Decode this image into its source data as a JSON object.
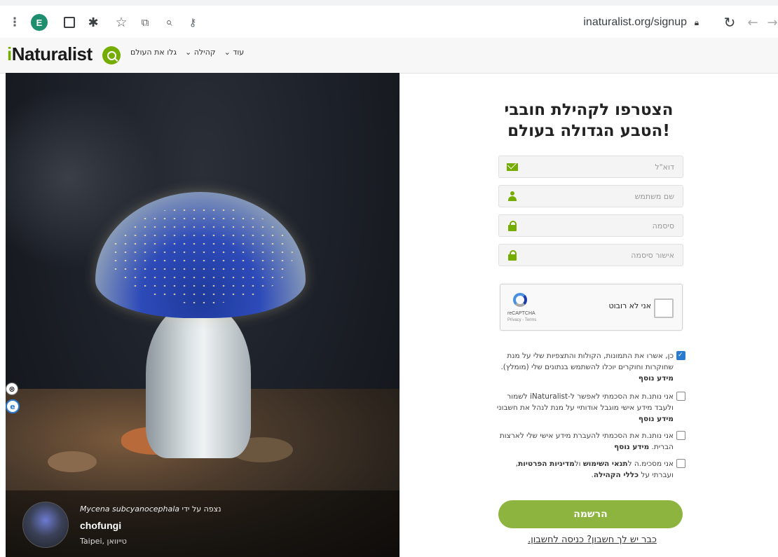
{
  "browser": {
    "url": "inaturalist.org/signup",
    "extension_letter": "E",
    "icons": [
      "menu-dots-icon",
      "extension-e-icon",
      "square-icon",
      "puzzle-icon",
      "star-icon",
      "tabs-icon",
      "search-icon",
      "key-icon",
      "lock-icon",
      "reload-icon",
      "back-icon",
      "forward-icon"
    ]
  },
  "nav": {
    "logo_i": "i",
    "logo_rest": "Naturalist",
    "links": [
      "גלו את העולם",
      "קהילה ⌄",
      "עוד ⌄"
    ]
  },
  "hero": {
    "observed_by": "נצפה על ידי",
    "species": "Mycena subcyanocephala",
    "user": "chofungi",
    "location": "Taipei, טייוואן",
    "side_badges": [
      "⊗",
      "e"
    ]
  },
  "form": {
    "title_line1": "הצטרפו לקהילת חובבי",
    "title_line2": "!הטבע הגדולה בעולם",
    "email_placeholder": "דוא\"ל",
    "username_placeholder": "שם משתמש",
    "password_placeholder": "סיסמה",
    "confirm_placeholder": "אישור סיסמה",
    "captcha_label": "אני לא רובוט",
    "captcha_brand": "reCAPTCHA",
    "captcha_terms": "Privacy - Terms",
    "consents": [
      {
        "checked": true,
        "text": "כן, אשרו את התמונות, הקולות והתצפיות שלי על מנת שחוקרות וחוקרים יוכלו להשתמש בנתונים שלי (מומלץ).",
        "more": "מידע נוסף"
      },
      {
        "checked": false,
        "text": "אני נותנ.ת את הסכמתי לאפשר ל-iNaturalist לשמור ולעבד מידע אישי מוגבל אודותיי על מנת לנהל את חשבוני",
        "more": "מידע נוסף"
      },
      {
        "checked": false,
        "text": "אני נותנ.ת את הסכמתי להעברת מידע אישי שלי לארצות הברית.",
        "more": "מידע נוסף"
      },
      {
        "checked": false,
        "text_pre": "אני מסכימ.ה ל",
        "terms": "תנאי השימוש",
        "and": " ול",
        "privacy": "מדיניות הפרטיות",
        "text_mid": ", ועברתי על ",
        "community": "כללי הקהילה",
        "end": "."
      }
    ],
    "signup_button": "הרשמה",
    "login_link": "כבר יש לך חשבון? כניסה לחשבון."
  }
}
